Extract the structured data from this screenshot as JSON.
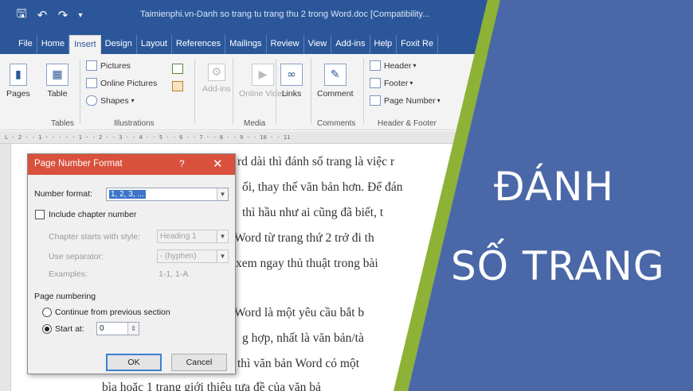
{
  "titlebar": {
    "doc_title": "Taimienphi.vn-Danh so trang tu trang thu 2 trong Word.doc [Compatibility..."
  },
  "tabs": [
    "File",
    "Home",
    "Insert",
    "Design",
    "Layout",
    "References",
    "Mailings",
    "Review",
    "View",
    "Add-ins",
    "Help",
    "Foxit Re"
  ],
  "active_tab": "Insert",
  "ribbon": {
    "pages": "Pages",
    "table": "Table",
    "pictures": "Pictures",
    "online_pictures": "Online Pictures",
    "shapes": "Shapes",
    "addins": "Add-ins",
    "online_video": "Online Video",
    "links": "Links",
    "comment": "Comment",
    "header": "Header",
    "footer": "Footer",
    "page_number": "Page Number",
    "groups": {
      "tables": "Tables",
      "illustrations": "Illustrations",
      "media": "Media",
      "comments": "Comments",
      "header_footer": "Header & Footer"
    }
  },
  "document": {
    "lines": [
      "rd dài thì đánh số trang là việc r",
      "ối, thay thế văn bản hơn. Để đán",
      "thì hầu như ai cũng đã biết, t",
      "Word từ trang thứ 2 trở đi th",
      "xem ngay thủ thuật trong bài",
      "Word là một yêu cầu bắt b",
      "g hợp, nhất là văn bản/tà",
      "thì văn bản Word có một",
      "bìa hoặc 1 trang giới thiệu tựa đề của văn bả"
    ]
  },
  "dialog": {
    "title": "Page Number Format",
    "help": "?",
    "close": "✕",
    "number_format_label": "Number format:",
    "number_format_value": "1, 2, 3, ...",
    "include_chapter": "Include chapter number",
    "chapter_style_label": "Chapter starts with style:",
    "chapter_style_value": "Heading 1",
    "separator_label": "Use separator:",
    "separator_value": "-  (hyphen)",
    "examples_label": "Examples:",
    "examples_value": "1-1, 1-A",
    "page_numbering_label": "Page numbering",
    "continue_label": "Continue from previous section",
    "start_at_label": "Start at:",
    "start_at_value": "0",
    "ok": "OK",
    "cancel": "Cancel"
  },
  "banner": {
    "line1": "ĐÁNH",
    "line2": "SỐ TRANG",
    "color": "#4a68a8",
    "stripe_color": "#8db236"
  }
}
